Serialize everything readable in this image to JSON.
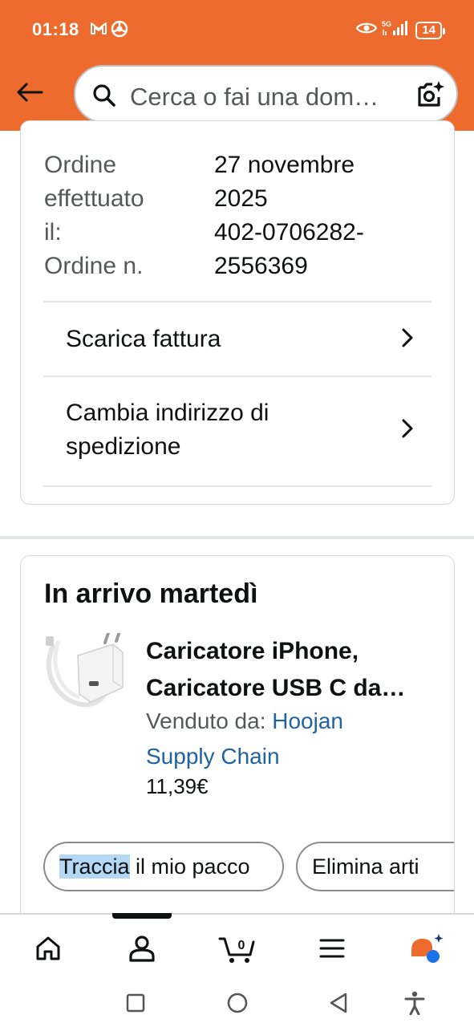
{
  "status_bar": {
    "time": "01:18",
    "battery": "14",
    "left_icons": [
      "gmail-icon",
      "chrome-icon"
    ],
    "right_icons": [
      "eye-icon",
      "signal-5g-icon",
      "battery-icon"
    ]
  },
  "header": {
    "back_icon": "arrow-left-icon",
    "search_placeholder": "Cerca o fai una dom…",
    "camera_icon": "camera-sparkle-icon"
  },
  "order": {
    "labels": [
      "Ordine",
      "effettuato",
      "il:",
      "Ordine n."
    ],
    "values": [
      "27 novembre",
      "2025",
      "402-0706282-",
      "2556369"
    ],
    "actions": [
      {
        "label": "Scarica fattura"
      },
      {
        "label_line1": "Cambia indirizzo di",
        "label_line2": "spedizione"
      }
    ]
  },
  "shipment": {
    "arrival": "In arrivo martedì",
    "product": {
      "title_line1": "Caricatore iPhone,",
      "title_line2": "Caricatore USB C da…",
      "sold_by_label": "Venduto da: ",
      "seller": "Hoojan Supply Chain",
      "price": "11,39€"
    },
    "buttons": {
      "track_highlight": "Traccia",
      "track_rest": " il mio pacco",
      "delete": "Elimina arti"
    }
  },
  "bottom_nav": {
    "items": [
      "home-icon",
      "account-icon",
      "cart-icon",
      "menu-icon",
      "rufus-ai-icon"
    ],
    "cart_count": "0",
    "active_index": 1
  },
  "system_nav": [
    "square-icon",
    "circle-icon",
    "triangle-back-icon",
    "accessibility-icon"
  ],
  "colors": {
    "header_bg": "#ec6b2d",
    "link": "#2162a1",
    "highlight": "#b3d7f5",
    "ai_orange": "#ec6b2d",
    "ai_blue": "#1a73e8"
  }
}
